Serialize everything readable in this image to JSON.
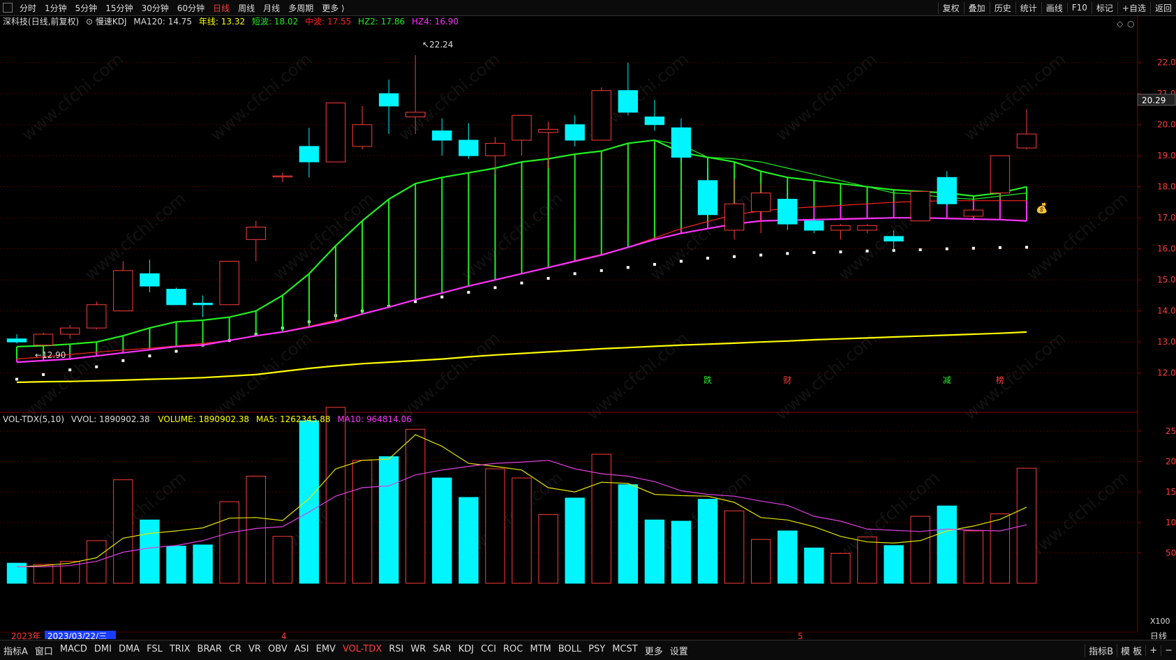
{
  "top_bar": {
    "periods": [
      {
        "label": "分时",
        "active": false
      },
      {
        "label": "1分钟",
        "active": false
      },
      {
        "label": "5分钟",
        "active": false
      },
      {
        "label": "15分钟",
        "active": false
      },
      {
        "label": "30分钟",
        "active": false
      },
      {
        "label": "60分钟",
        "active": false
      },
      {
        "label": "日线",
        "active": true
      },
      {
        "label": "周线",
        "active": false
      },
      {
        "label": "月线",
        "active": false
      },
      {
        "label": "多周期",
        "active": false
      },
      {
        "label": "更多 ⟩",
        "active": false
      }
    ],
    "tools": [
      "复权",
      "叠加",
      "历史",
      "统计",
      "画线",
      "F10",
      "标记",
      "+自选",
      "返回"
    ]
  },
  "colors": {
    "background": "#000000",
    "grid": "#4a0000",
    "up": "#ff3b3b",
    "down": "#00f5ff",
    "short_wave": "#22ee22",
    "mid_wave": "#ff2222",
    "hz2": "#22ee22",
    "hz4": "#ff33ff",
    "ma120": "#ffff00",
    "dots": "#ffffff",
    "ma5": "#e6e600",
    "ma10": "#e040e0"
  },
  "price_panel": {
    "stock_name": "深科技",
    "period_label": "(日线,前复权)",
    "indicator_name": "慢速KDJ",
    "ma120_label": "MA120: 14.75",
    "long_label": "年线: 13.32",
    "short_label": "短波: 18.02",
    "mid_label": "中波: 17.55",
    "hz2_label": "HZ2: 17.86",
    "hz4_label": "HZ4: 16.90",
    "high_label": "22.24",
    "low_label": "12.90",
    "current_price": "20.29",
    "event_tags": [
      "跌",
      "财",
      "减",
      "榜"
    ]
  },
  "volume_panel": {
    "indicator_label": "VOL-TDX(5,10)",
    "vvol_label": "VVOL: 1890902.38",
    "volume_label": "VOLUME: 1890902.38",
    "ma5_label": "MA5: 1262345.88",
    "ma10_label": "MA10: 964814.06",
    "unit_label": "X100"
  },
  "axis_labels": {
    "year": "2023年",
    "selected_date": "2023/03/22/三",
    "month4": "4",
    "month5": "5",
    "period": "日线"
  },
  "chart_data": [
    {
      "type": "candlestick",
      "title": "深科技 (日线,前复权)",
      "ylim": [
        11.7,
        22.6
      ],
      "yticks": [
        12,
        13,
        14,
        15,
        16,
        17,
        18,
        19,
        20,
        21,
        22
      ],
      "candles": [
        {
          "o": 13.1,
          "h": 13.25,
          "l": 12.95,
          "c": 13.0
        },
        {
          "o": 12.9,
          "h": 13.3,
          "l": 12.9,
          "c": 13.25
        },
        {
          "o": 13.25,
          "h": 13.55,
          "l": 13.1,
          "c": 13.45
        },
        {
          "o": 13.45,
          "h": 14.3,
          "l": 13.4,
          "c": 14.2
        },
        {
          "o": 14.0,
          "h": 15.6,
          "l": 14.0,
          "c": 15.3
        },
        {
          "o": 15.2,
          "h": 15.65,
          "l": 14.6,
          "c": 14.8
        },
        {
          "o": 14.7,
          "h": 14.75,
          "l": 14.2,
          "c": 14.2
        },
        {
          "o": 14.25,
          "h": 14.5,
          "l": 13.8,
          "c": 14.2
        },
        {
          "o": 14.2,
          "h": 15.6,
          "l": 14.2,
          "c": 15.6
        },
        {
          "o": 16.3,
          "h": 16.9,
          "l": 15.6,
          "c": 16.7
        },
        {
          "o": 18.35,
          "h": 18.45,
          "l": 18.15,
          "c": 18.35
        },
        {
          "o": 19.3,
          "h": 19.9,
          "l": 18.3,
          "c": 18.8
        },
        {
          "o": 18.8,
          "h": 20.7,
          "l": 18.8,
          "c": 20.7
        },
        {
          "o": 19.3,
          "h": 20.6,
          "l": 19.2,
          "c": 20.0
        },
        {
          "o": 21.0,
          "h": 21.45,
          "l": 19.7,
          "c": 20.6
        },
        {
          "o": 20.25,
          "h": 22.24,
          "l": 19.7,
          "c": 20.4
        },
        {
          "o": 19.8,
          "h": 20.2,
          "l": 19.0,
          "c": 19.5
        },
        {
          "o": 19.5,
          "h": 20.05,
          "l": 18.9,
          "c": 19.0
        },
        {
          "o": 19.0,
          "h": 19.6,
          "l": 18.4,
          "c": 19.4
        },
        {
          "o": 19.5,
          "h": 20.3,
          "l": 19.0,
          "c": 20.3
        },
        {
          "o": 19.75,
          "h": 20.1,
          "l": 18.6,
          "c": 19.85
        },
        {
          "o": 20.0,
          "h": 20.3,
          "l": 19.3,
          "c": 19.5
        },
        {
          "o": 19.5,
          "h": 21.2,
          "l": 19.5,
          "c": 21.1
        },
        {
          "o": 21.1,
          "h": 22.0,
          "l": 20.3,
          "c": 20.4
        },
        {
          "o": 20.25,
          "h": 20.8,
          "l": 19.8,
          "c": 20.0
        },
        {
          "o": 19.9,
          "h": 20.2,
          "l": 18.8,
          "c": 18.95
        },
        {
          "o": 18.2,
          "h": 18.6,
          "l": 17.1,
          "c": 17.1
        },
        {
          "o": 16.6,
          "h": 18.25,
          "l": 16.3,
          "c": 17.45
        },
        {
          "o": 17.2,
          "h": 18.1,
          "l": 16.5,
          "c": 17.8
        },
        {
          "o": 17.6,
          "h": 17.95,
          "l": 16.6,
          "c": 16.8
        },
        {
          "o": 16.9,
          "h": 17.0,
          "l": 16.5,
          "c": 16.6
        },
        {
          "o": 16.6,
          "h": 16.8,
          "l": 16.3,
          "c": 16.75
        },
        {
          "o": 16.6,
          "h": 16.8,
          "l": 16.5,
          "c": 16.75
        },
        {
          "o": 16.4,
          "h": 16.6,
          "l": 15.95,
          "c": 16.25
        },
        {
          "o": 16.9,
          "h": 17.8,
          "l": 16.9,
          "c": 17.85
        },
        {
          "o": 18.3,
          "h": 18.5,
          "l": 17.4,
          "c": 17.45
        },
        {
          "o": 17.05,
          "h": 17.3,
          "l": 16.9,
          "c": 17.25
        },
        {
          "o": 17.8,
          "h": 19.0,
          "l": 17.6,
          "c": 19.0
        },
        {
          "o": 19.25,
          "h": 20.5,
          "l": 19.2,
          "c": 19.7
        }
      ],
      "lines": [
        {
          "name": "短波",
          "values": [
            12.85,
            12.88,
            12.93,
            13.0,
            13.2,
            13.45,
            13.65,
            13.7,
            13.8,
            14.0,
            14.5,
            15.2,
            16.1,
            16.9,
            17.6,
            18.1,
            18.3,
            18.45,
            18.6,
            18.8,
            18.9,
            19.05,
            19.15,
            19.4,
            19.5,
            19.35,
            18.95,
            18.9,
            18.8,
            18.6,
            18.4,
            18.2,
            18.0,
            17.8,
            17.75,
            17.65,
            17.6,
            17.7,
            17.8
          ]
        },
        {
          "name": "中波",
          "values": [
            12.45,
            12.52,
            12.6,
            12.67,
            12.74,
            12.8,
            12.87,
            12.95,
            13.05,
            13.2,
            13.33,
            13.5,
            13.7,
            13.9,
            14.12,
            14.36,
            14.58,
            14.8,
            15.0,
            15.2,
            15.4,
            15.62,
            15.82,
            16.05,
            16.35,
            16.65,
            16.88,
            17.1,
            17.22,
            17.3,
            17.35,
            17.4,
            17.45,
            17.5,
            17.53,
            17.55,
            17.55,
            17.55,
            17.55
          ]
        },
        {
          "name": "HZ2",
          "values": [
            12.85,
            12.88,
            12.93,
            13.0,
            13.2,
            13.45,
            13.65,
            13.7,
            13.8,
            14.0,
            14.5,
            15.2,
            16.1,
            16.9,
            17.6,
            18.1,
            18.3,
            18.45,
            18.6,
            18.8,
            18.9,
            19.05,
            19.15,
            19.4,
            19.5,
            19.1,
            18.95,
            18.8,
            18.5,
            18.3,
            18.2,
            18.1,
            18.0,
            17.9,
            17.85,
            17.8,
            17.7,
            17.8,
            18.0
          ]
        },
        {
          "name": "HZ4",
          "values": [
            12.35,
            12.4,
            12.45,
            12.55,
            12.65,
            12.75,
            12.85,
            12.9,
            13.05,
            13.2,
            13.32,
            13.48,
            13.65,
            13.9,
            14.12,
            14.36,
            14.58,
            14.8,
            15.0,
            15.2,
            15.4,
            15.6,
            15.8,
            16.05,
            16.3,
            16.5,
            16.65,
            16.8,
            16.9,
            16.92,
            16.94,
            16.96,
            16.98,
            17.0,
            17.0,
            16.98,
            16.96,
            16.94,
            16.9
          ]
        },
        {
          "name": "年线",
          "values": [
            11.7,
            11.72,
            11.73,
            11.75,
            11.77,
            11.8,
            11.82,
            11.85,
            11.9,
            11.95,
            12.05,
            12.15,
            12.23,
            12.3,
            12.35,
            12.4,
            12.45,
            12.52,
            12.58,
            12.63,
            12.68,
            12.73,
            12.78,
            12.82,
            12.86,
            12.9,
            12.93,
            12.96,
            13.0,
            13.03,
            13.07,
            13.1,
            13.13,
            13.16,
            13.19,
            13.22,
            13.25,
            13.28,
            13.32
          ]
        },
        {
          "name": "MA120",
          "values": [
            11.8,
            11.95,
            12.1,
            12.2,
            12.4,
            12.55,
            12.7,
            12.9,
            13.05,
            13.25,
            13.45,
            13.65,
            13.85,
            14.0,
            14.15,
            14.3,
            14.45,
            14.6,
            14.75,
            14.9,
            15.05,
            15.2,
            15.3,
            15.4,
            15.5,
            15.6,
            15.7,
            15.75,
            15.8,
            15.85,
            15.88,
            15.9,
            15.93,
            15.95,
            15.97,
            16.0,
            16.02,
            16.04,
            16.05
          ]
        }
      ]
    },
    {
      "type": "bar",
      "title": "VOL-TDX(5,10)",
      "ylabel": "X100",
      "ylim": [
        0,
        29000
      ],
      "yticks": [
        5000,
        10000,
        15000,
        20000,
        25000
      ],
      "values": [
        3300,
        3100,
        3600,
        7000,
        17000,
        10400,
        6100,
        6300,
        13400,
        17600,
        7700,
        26700,
        28900,
        20200,
        20800,
        25300,
        17300,
        14100,
        18800,
        17300,
        11300,
        14000,
        21200,
        16200,
        10400,
        10200,
        13800,
        11900,
        7200,
        8600,
        5800,
        4900,
        7600,
        6200,
        11000,
        12700,
        8600,
        11400,
        18900
      ],
      "series": [
        {
          "name": "MA5",
          "values": [
            2700,
            2900,
            3300,
            4200,
            7400,
            8200,
            8600,
            9100,
            10700,
            10800,
            10300,
            13900,
            18800,
            20200,
            20400,
            24400,
            22500,
            19700,
            19200,
            18600,
            15700,
            15000,
            16600,
            16400,
            14600,
            14400,
            14300,
            13300,
            10800,
            10400,
            9300,
            7700,
            6800,
            6600,
            7000,
            8600,
            9400,
            10500,
            12500
          ]
        },
        {
          "name": "MA10",
          "values": [
            2700,
            2700,
            2900,
            3600,
            5100,
            5800,
            6200,
            7000,
            8300,
            9000,
            9300,
            11700,
            14300,
            15700,
            16000,
            17800,
            18600,
            19200,
            19700,
            19900,
            20200,
            18800,
            18000,
            17600,
            16700,
            15200,
            14600,
            14300,
            13500,
            12800,
            11000,
            10200,
            8900,
            8700,
            8500,
            8900,
            8700,
            8600,
            9600
          ]
        }
      ]
    }
  ]
}
